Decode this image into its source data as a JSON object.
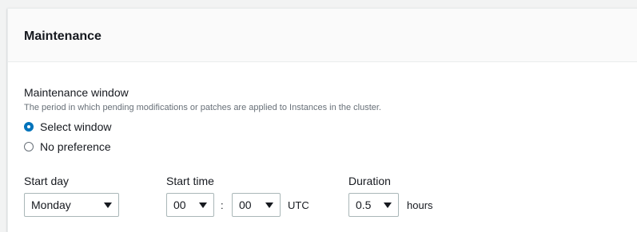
{
  "section": {
    "title": "Maintenance"
  },
  "maintenance_window": {
    "label": "Maintenance window",
    "description": "The period in which pending modifications or patches are applied to Instances in the cluster.",
    "options": [
      {
        "label": "Select window",
        "selected": true
      },
      {
        "label": "No preference",
        "selected": false
      }
    ]
  },
  "start_day": {
    "label": "Start day",
    "value": "Monday"
  },
  "start_time": {
    "label": "Start time",
    "hour": "00",
    "separator": ":",
    "minute": "00",
    "timezone": "UTC"
  },
  "duration": {
    "label": "Duration",
    "value": "0.5",
    "unit": "hours"
  },
  "colors": {
    "accent": "#0073bb",
    "header_bg": "#fafafa",
    "border": "#aab7b8",
    "muted_text": "#687078"
  },
  "icons": {
    "dropdown": "caret-down-icon"
  }
}
